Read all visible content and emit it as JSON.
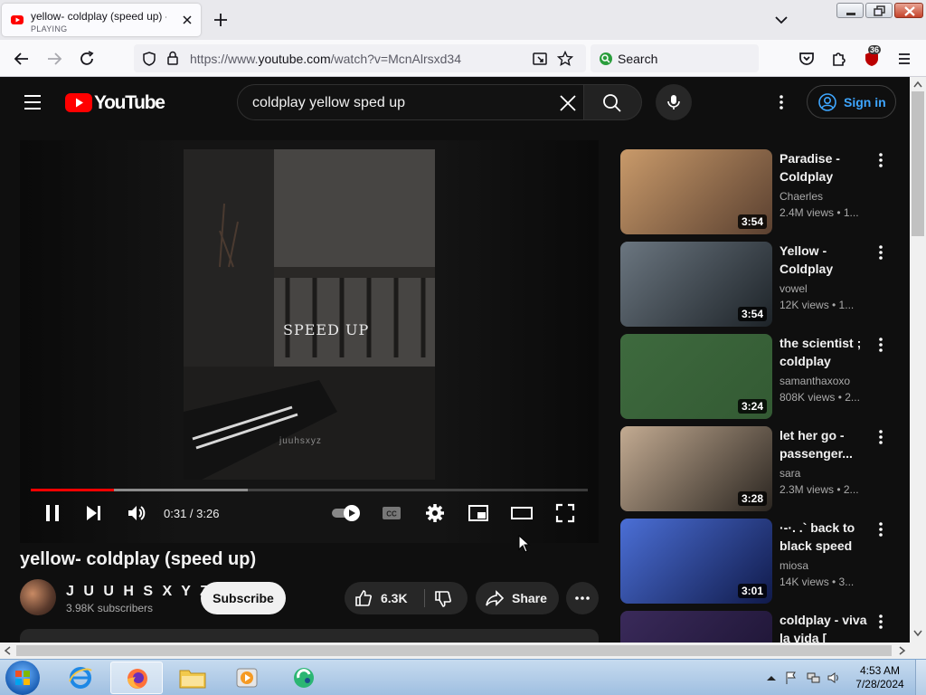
{
  "browser": {
    "tab_title": "yellow- coldplay (speed up) - YouTube",
    "tab_status": "PLAYING",
    "url_prefix": "https://www.",
    "url_domain": "youtube.com",
    "url_path": "/watch?v=McnAlrsxd34",
    "search_placeholder": "Search",
    "extension_badge": "36"
  },
  "youtube": {
    "logo_text": "YouTube",
    "search_query": "coldplay yellow sped up",
    "sign_in_label": "Sign in"
  },
  "player": {
    "overlay_text": "SPEED UP",
    "watermark_text": "juuhsxyz",
    "time_display": "0:31 / 3:26",
    "progress_fraction": 0.15,
    "buffered_fraction": 0.39
  },
  "video": {
    "title": "yellow- coldplay (speed up)",
    "channel": "J U U H S X Y Z 🐚",
    "subscribers": "3.98K subscribers",
    "subscribe_label": "Subscribe",
    "likes": "6.3K",
    "share_label": "Share"
  },
  "recommendations": [
    {
      "title": "Paradise - Coldplay (spe...",
      "channel": "Chaerles",
      "meta": "2.4M views • 1...",
      "duration": "3:54",
      "colors": [
        "#c99a6a",
        "#5a4030"
      ]
    },
    {
      "title": "Yellow - Coldplay (spe...",
      "channel": "vowel",
      "meta": "12K views • 1...",
      "duration": "3:54",
      "colors": [
        "#6b7680",
        "#1d2328"
      ]
    },
    {
      "title": "the scientist ; coldplay [spe...",
      "channel": "samanthaxoxo",
      "meta": "808K views • 2...",
      "duration": "3:24",
      "colors": [
        "#3e6a3e",
        "#335a33"
      ]
    },
    {
      "title": "let her go - passenger...",
      "channel": "sara",
      "meta": "2.3M views • 2...",
      "duration": "3:28",
      "colors": [
        "#c3ab92",
        "#2a2520"
      ]
    },
    {
      "title": "·-·. .` back to black speed u...",
      "channel": "miosa",
      "meta": "14K views • 3...",
      "duration": "3:01",
      "colors": [
        "#4b6fd6",
        "#101a4a"
      ]
    },
    {
      "title": "coldplay - viva la vida [ sped...",
      "channel": "",
      "meta": "",
      "duration": "",
      "colors": [
        "#3a2a5a",
        "#1a1230"
      ]
    }
  ],
  "taskbar": {
    "time": "4:53 AM",
    "date": "7/28/2024"
  },
  "colors": {
    "youtube_red": "#ff0000",
    "accent_blue": "#3ea6ff",
    "bg": "#0f0f0f"
  }
}
